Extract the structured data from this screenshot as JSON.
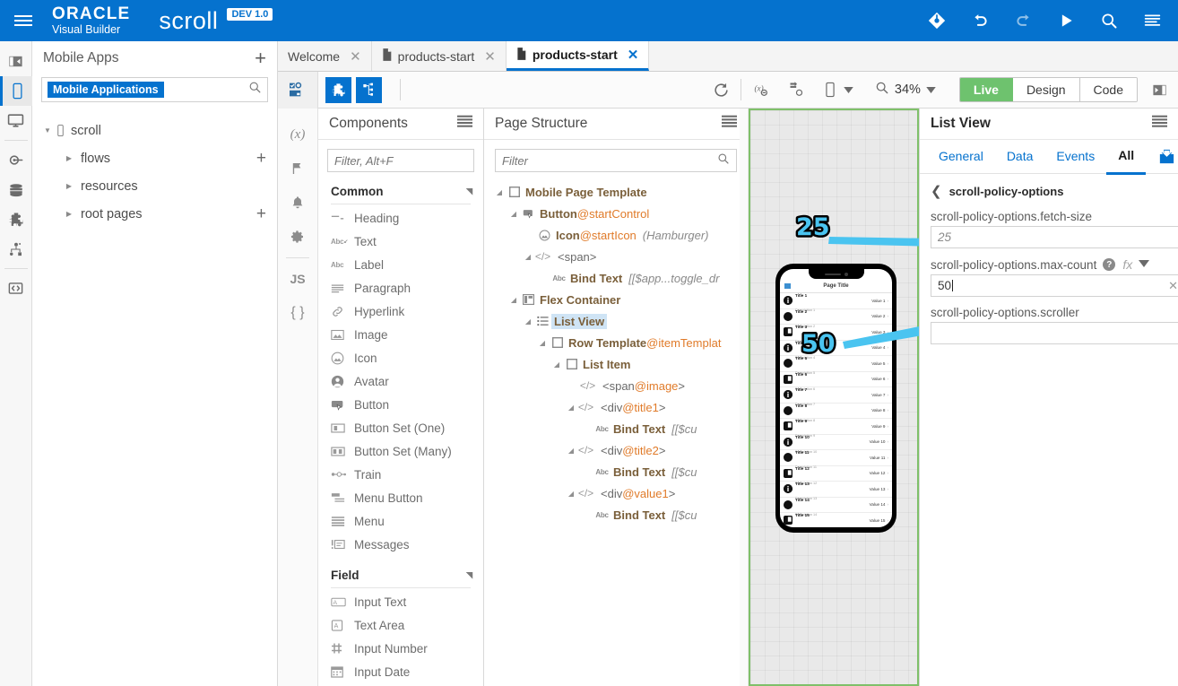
{
  "header": {
    "brand_line1": "ORACLE",
    "brand_line2": "Visual Builder",
    "app_name": "scroll",
    "badge": "DEV 1.0",
    "accent": "#0572ce",
    "icons": [
      "git-icon",
      "undo-icon",
      "redo-icon",
      "play-icon",
      "search-icon",
      "menu-icon"
    ]
  },
  "left_rail": {
    "items": [
      {
        "name": "collapse-panel-icon"
      },
      {
        "name": "mobile-apps-icon",
        "selected": true
      },
      {
        "name": "web-apps-icon"
      },
      {
        "name": "service-connections-icon"
      },
      {
        "name": "business-objects-icon"
      },
      {
        "name": "components-icon"
      },
      {
        "name": "process-icon"
      },
      {
        "name": "source-view-icon"
      }
    ]
  },
  "apps_panel": {
    "title": "Mobile Apps",
    "add_label": "+",
    "search_chip": "Mobile Applications",
    "tree": [
      {
        "label": "scroll",
        "icon": "mobile-icon",
        "expanded": true,
        "indent": 0,
        "add": false
      },
      {
        "label": "flows",
        "icon": "",
        "expanded": false,
        "indent": 1,
        "add": true
      },
      {
        "label": "resources",
        "icon": "",
        "expanded": false,
        "indent": 1,
        "add": false
      },
      {
        "label": "root pages",
        "icon": "",
        "expanded": false,
        "indent": 1,
        "add": true
      }
    ]
  },
  "tabs": [
    {
      "label": "Welcome",
      "active": false,
      "has_doc_icon": false
    },
    {
      "label": "products-start",
      "active": false,
      "has_doc_icon": true
    },
    {
      "label": "products-start",
      "active": true,
      "has_doc_icon": true
    }
  ],
  "toolbar": {
    "reload_icon": "refresh-icon",
    "variables_icon": "variables-icon",
    "actions_icon": "action-chains-icon",
    "device_icon": "device-icon",
    "zoom_label": "34%",
    "modes": [
      {
        "label": "Live",
        "active": true
      },
      {
        "label": "Design",
        "active": false
      },
      {
        "label": "Code",
        "active": false
      }
    ],
    "expand_icon": "expand-panel-icon"
  },
  "rail2": {
    "items": [
      {
        "glyph": "(x)",
        "name": "variables-icon"
      },
      {
        "glyph": "flag",
        "name": "flag-icon"
      },
      {
        "glyph": "bell",
        "name": "bell-icon"
      },
      {
        "glyph": "gear",
        "name": "gear-icon"
      },
      {
        "glyph": "JS",
        "name": "javascript-icon"
      },
      {
        "glyph": "{ }",
        "name": "json-icon"
      }
    ]
  },
  "components": {
    "title": "Components",
    "filter_placeholder": "Filter, Alt+F",
    "groups": [
      {
        "name": "Common",
        "items": [
          {
            "label": "Heading",
            "icon": "heading-icon"
          },
          {
            "label": "Text",
            "icon": "text-icon"
          },
          {
            "label": "Label",
            "icon": "label-icon"
          },
          {
            "label": "Paragraph",
            "icon": "paragraph-icon"
          },
          {
            "label": "Hyperlink",
            "icon": "link-icon"
          },
          {
            "label": "Image",
            "icon": "image-icon"
          },
          {
            "label": "Icon",
            "icon": "icon-icon"
          },
          {
            "label": "Avatar",
            "icon": "avatar-icon"
          },
          {
            "label": "Button",
            "icon": "button-icon"
          },
          {
            "label": "Button Set (One)",
            "icon": "button-set-one-icon"
          },
          {
            "label": "Button Set (Many)",
            "icon": "button-set-many-icon"
          },
          {
            "label": "Train",
            "icon": "train-icon"
          },
          {
            "label": "Menu Button",
            "icon": "menu-button-icon"
          },
          {
            "label": "Menu",
            "icon": "menu-icon"
          },
          {
            "label": "Messages",
            "icon": "messages-icon"
          }
        ]
      },
      {
        "name": "Field",
        "items": [
          {
            "label": "Input Text",
            "icon": "input-text-icon"
          },
          {
            "label": "Text Area",
            "icon": "text-area-icon"
          },
          {
            "label": "Input Number",
            "icon": "input-number-icon"
          },
          {
            "label": "Input Date",
            "icon": "input-date-icon"
          }
        ]
      }
    ]
  },
  "page_structure": {
    "title": "Page Structure",
    "filter_placeholder": "Filter",
    "rows": [
      {
        "indent": 0,
        "twisty": "down",
        "icon": "checkbox-icon",
        "name": "Mobile Page Template",
        "at": "",
        "tag": "",
        "hint": "",
        "selected": false
      },
      {
        "indent": 1,
        "twisty": "down",
        "icon": "button-icon",
        "name": "Button",
        "at": "@startControl",
        "tag": "",
        "hint": "",
        "selected": false
      },
      {
        "indent": 2,
        "twisty": "",
        "icon": "icon-icon",
        "name": "Icon",
        "at": "@startIcon",
        "tag": "",
        "hint": "(Hamburger)",
        "selected": false
      },
      {
        "indent": 2,
        "twisty": "down",
        "icon": "code-icon",
        "name": "",
        "at": "",
        "tag": "<span>",
        "hint": "",
        "selected": false
      },
      {
        "indent": 3,
        "twisty": "",
        "icon": "text-icon",
        "name": "Bind Text",
        "at": "",
        "tag": "",
        "hint": "[[$app...toggle_dr",
        "selected": false
      },
      {
        "indent": 1,
        "twisty": "down",
        "icon": "flex-icon",
        "name": "Flex Container",
        "at": "",
        "tag": "",
        "hint": "",
        "selected": false
      },
      {
        "indent": 2,
        "twisty": "down",
        "icon": "list-icon",
        "name": "List View",
        "at": "",
        "tag": "",
        "hint": "",
        "selected": true
      },
      {
        "indent": 3,
        "twisty": "down",
        "icon": "checkbox-icon",
        "name": "Row Template",
        "at": "@itemTemplat",
        "tag": "",
        "hint": "",
        "selected": false
      },
      {
        "indent": 4,
        "twisty": "down",
        "icon": "checkbox-icon",
        "name": "List Item",
        "at": "",
        "tag": "",
        "hint": "",
        "selected": false
      },
      {
        "indent": 5,
        "twisty": "",
        "icon": "code-icon",
        "name": "",
        "at": "@image",
        "tag": "span",
        "hint": "",
        "selected": false
      },
      {
        "indent": 5,
        "twisty": "down",
        "icon": "code-icon",
        "name": "",
        "at": "@title1",
        "tag": "div",
        "hint": "",
        "selected": false
      },
      {
        "indent": 6,
        "twisty": "",
        "icon": "text-icon",
        "name": "Bind Text",
        "at": "",
        "tag": "",
        "hint": "[[$cu",
        "selected": false
      },
      {
        "indent": 5,
        "twisty": "down",
        "icon": "code-icon",
        "name": "",
        "at": "@title2",
        "tag": "div",
        "hint": "",
        "selected": false
      },
      {
        "indent": 6,
        "twisty": "",
        "icon": "text-icon",
        "name": "Bind Text",
        "at": "",
        "tag": "",
        "hint": "[[$cu",
        "selected": false
      },
      {
        "indent": 5,
        "twisty": "down",
        "icon": "code-icon",
        "name": "",
        "at": "@value1",
        "tag": "div",
        "hint": "",
        "selected": false
      },
      {
        "indent": 6,
        "twisty": "",
        "icon": "text-icon",
        "name": "Bind Text",
        "at": "",
        "tag": "",
        "hint": "[[$cu",
        "selected": false
      }
    ]
  },
  "canvas": {
    "frame_color": "#7fc06a",
    "annotations": [
      {
        "text": "25",
        "name": "annotation-25"
      },
      {
        "text": "50",
        "name": "annotation-50"
      }
    ],
    "phone": {
      "title": "Page Title",
      "rows": [
        {
          "title": "Title 1",
          "desc": "Description 1",
          "value": "Value 1",
          "avatar": "info"
        },
        {
          "title": "Title 2",
          "desc": "Description 2",
          "value": "Value 2",
          "avatar": "bell"
        },
        {
          "title": "Title 3",
          "desc": "Description 3",
          "value": "Value 3",
          "avatar": "copy"
        },
        {
          "title": "Title 4",
          "desc": "Description 4",
          "value": "Value 4",
          "avatar": "info"
        },
        {
          "title": "Title 5",
          "desc": "Description 5",
          "value": "Value 5",
          "avatar": "bell"
        },
        {
          "title": "Title 6",
          "desc": "Description 6",
          "value": "Value 6",
          "avatar": "copy"
        },
        {
          "title": "Title 7",
          "desc": "Description 7",
          "value": "Value 7",
          "avatar": "info"
        },
        {
          "title": "Title 8",
          "desc": "Description 8",
          "value": "Value 8",
          "avatar": "bell"
        },
        {
          "title": "Title 9",
          "desc": "Description 9",
          "value": "Value 9",
          "avatar": "copy"
        },
        {
          "title": "Title 10",
          "desc": "Description 10",
          "value": "Value 10",
          "avatar": "info"
        },
        {
          "title": "Title 11",
          "desc": "Description 11",
          "value": "Value 11",
          "avatar": "bell"
        },
        {
          "title": "Title 12",
          "desc": "Description 12",
          "value": "Value 12",
          "avatar": "copy"
        },
        {
          "title": "Title 13",
          "desc": "Description 13",
          "value": "Value 13",
          "avatar": "info"
        },
        {
          "title": "Title 14",
          "desc": "Description 14",
          "value": "Value 14",
          "avatar": "bell"
        },
        {
          "title": "Title 15",
          "desc": "Description 15",
          "value": "Value 15",
          "avatar": "copy"
        }
      ]
    }
  },
  "properties": {
    "title": "List View",
    "tabs": [
      {
        "label": "General",
        "active": false
      },
      {
        "label": "Data",
        "active": false
      },
      {
        "label": "Events",
        "active": false
      },
      {
        "label": "All",
        "active": true
      }
    ],
    "breadcrumb": "scroll-policy-options",
    "fields": [
      {
        "label": "scroll-policy-options.fetch-size",
        "value": "25",
        "placeholder_style": true,
        "has_help": false,
        "has_fx": false,
        "has_clear": false,
        "focused": false
      },
      {
        "label": "scroll-policy-options.max-count",
        "value": "50",
        "placeholder_style": false,
        "has_help": true,
        "has_fx": true,
        "has_clear": true,
        "focused": true
      },
      {
        "label": "scroll-policy-options.scroller",
        "value": "",
        "placeholder_style": false,
        "has_help": false,
        "has_fx": false,
        "has_clear": false,
        "focused": false
      }
    ]
  }
}
